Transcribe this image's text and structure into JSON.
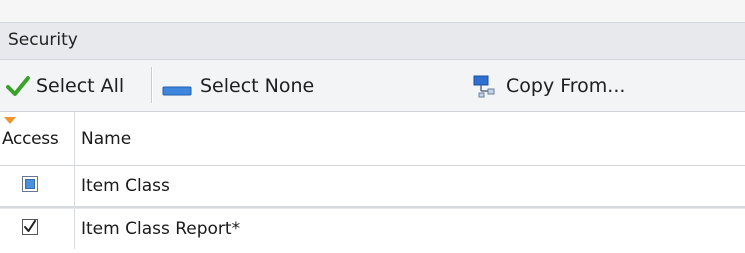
{
  "panel": {
    "title": "Security"
  },
  "toolbar": {
    "select_all": {
      "label": "Select All",
      "icon": "checkmark-icon"
    },
    "select_none": {
      "label": "Select None",
      "icon": "blue-bar-icon"
    },
    "copy_from": {
      "label": "Copy From...",
      "icon": "network-copy-icon"
    }
  },
  "grid": {
    "columns": [
      "Access",
      "Name"
    ],
    "rows": [
      {
        "access": "indeterminate",
        "name": "Item Class"
      },
      {
        "access": "checked",
        "name": "Item Class Report*"
      }
    ]
  },
  "colors": {
    "accent": "#4f8fd8",
    "check_green": "#3aa12a",
    "sort_marker": "#f0932b"
  }
}
